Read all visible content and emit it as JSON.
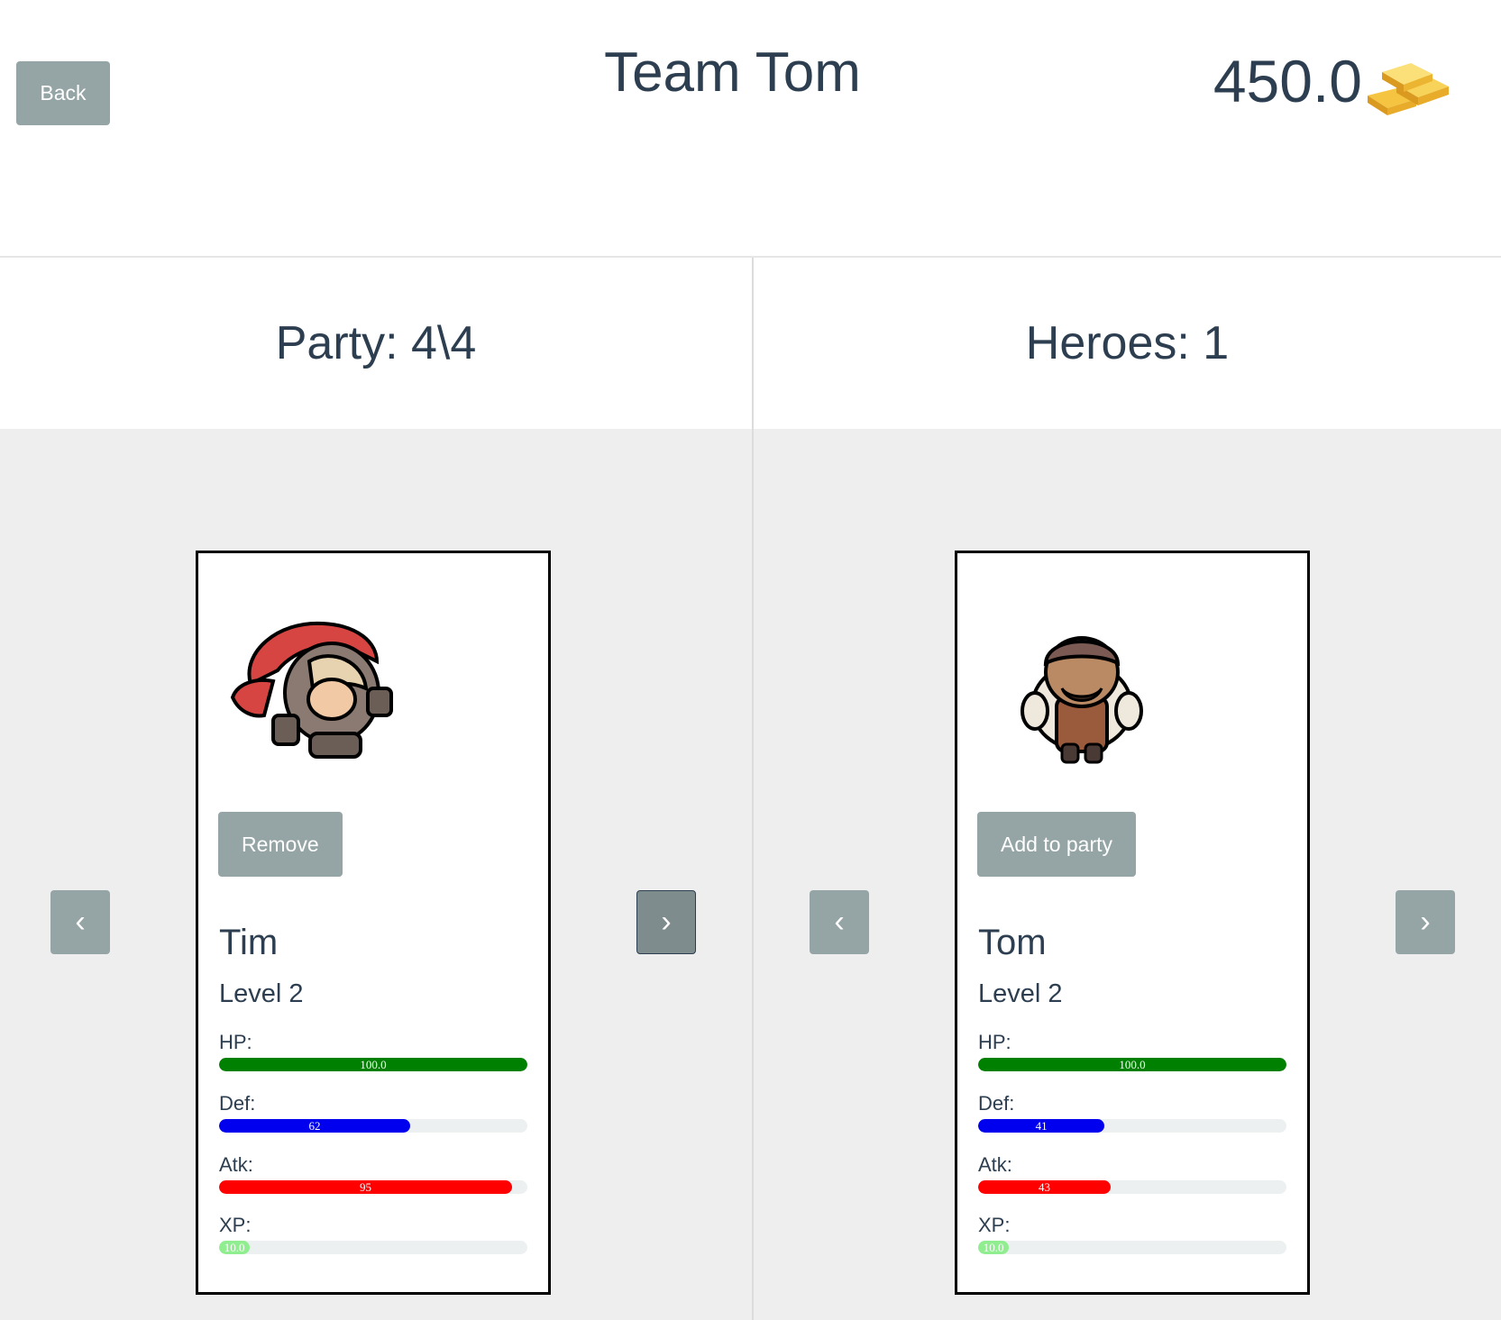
{
  "header": {
    "back_label": "Back",
    "title": "Team Tom",
    "gold_amount": "450.0",
    "gold_icon": "gold-bars-icon"
  },
  "party": {
    "heading": "Party: 4\\4",
    "prev_label": "‹",
    "next_label": "›",
    "hero": {
      "action_label": "Remove",
      "name": "Tim",
      "level": "Level 2",
      "stats": [
        {
          "label": "HP:",
          "value": "100.0",
          "fraction": 1.0,
          "color": "#008000"
        },
        {
          "label": "Def:",
          "value": "62",
          "fraction": 0.62,
          "color": "#0000ee"
        },
        {
          "label": "Atk:",
          "value": "95",
          "fraction": 0.95,
          "color": "#ff0000"
        },
        {
          "label": "XP:",
          "value": "10.0",
          "fraction": 0.1,
          "color": "#90ee90"
        }
      ]
    }
  },
  "heroes": {
    "heading": "Heroes: 1",
    "prev_label": "‹",
    "next_label": "›",
    "hero": {
      "action_label": "Add to party",
      "name": "Tom",
      "level": "Level 2",
      "stats": [
        {
          "label": "HP:",
          "value": "100.0",
          "fraction": 1.0,
          "color": "#008000"
        },
        {
          "label": "Def:",
          "value": "41",
          "fraction": 0.41,
          "color": "#0000ee"
        },
        {
          "label": "Atk:",
          "value": "43",
          "fraction": 0.43,
          "color": "#ff0000"
        },
        {
          "label": "XP:",
          "value": "10.0",
          "fraction": 0.1,
          "color": "#90ee90"
        }
      ]
    }
  }
}
